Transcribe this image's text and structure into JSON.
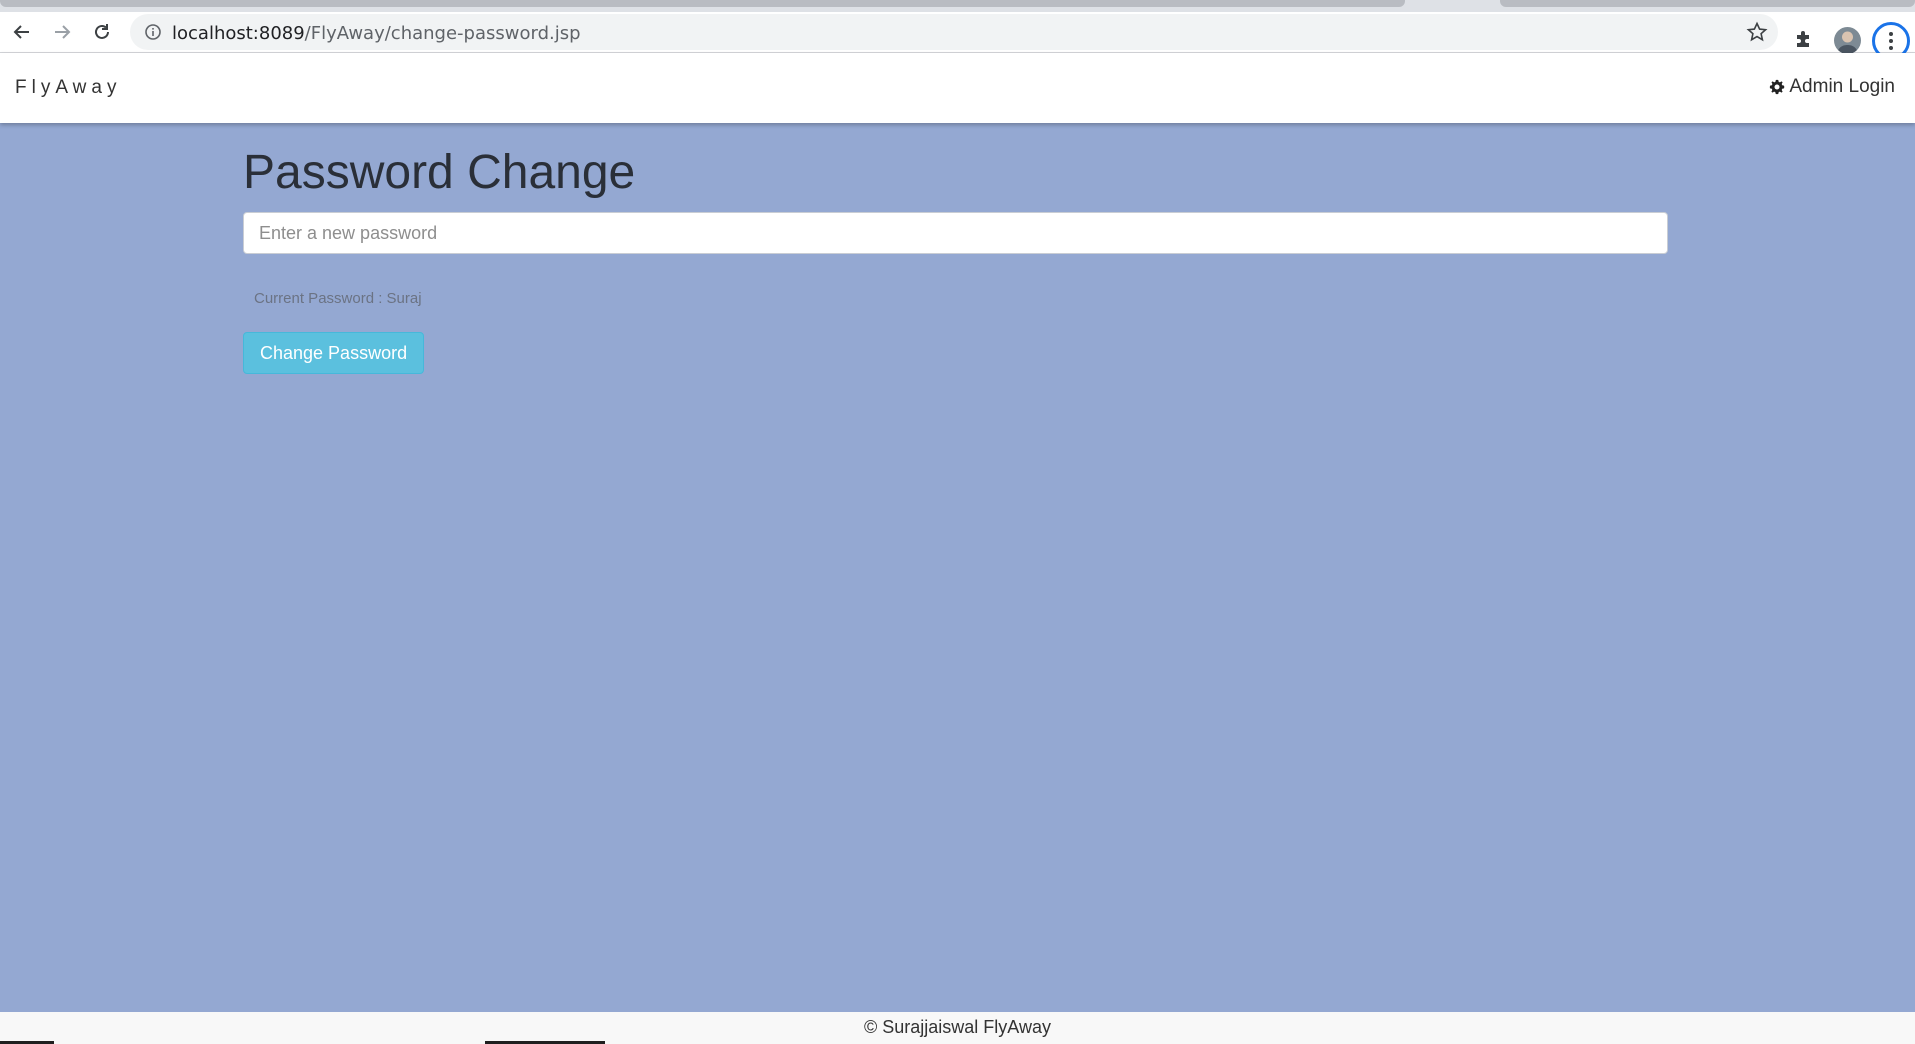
{
  "browser": {
    "url_host": "localhost:8089",
    "url_path": "/FlyAway/change-password.jsp"
  },
  "navbar": {
    "brand": "FlyAway",
    "admin_login_label": "Admin Login"
  },
  "main": {
    "title": "Password Change",
    "new_password_placeholder": "Enter a new password",
    "new_password_value": "",
    "current_password_text": "Current Password : Suraj",
    "change_button_label": "Change Password"
  },
  "footer": {
    "text": "© Surajjaiswal FlyAway"
  },
  "icons": {
    "back": "arrow-left-icon",
    "forward": "arrow-right-icon",
    "reload": "reload-icon",
    "site_info": "info-icon",
    "bookmark": "star-icon",
    "extensions": "puzzle-icon",
    "profile": "avatar",
    "menu": "kebab-menu-icon",
    "admin": "gear-icon"
  },
  "colors": {
    "page_background": "#94a8d2",
    "button_info": "#5bc0de",
    "navbar_background": "#ffffff"
  }
}
